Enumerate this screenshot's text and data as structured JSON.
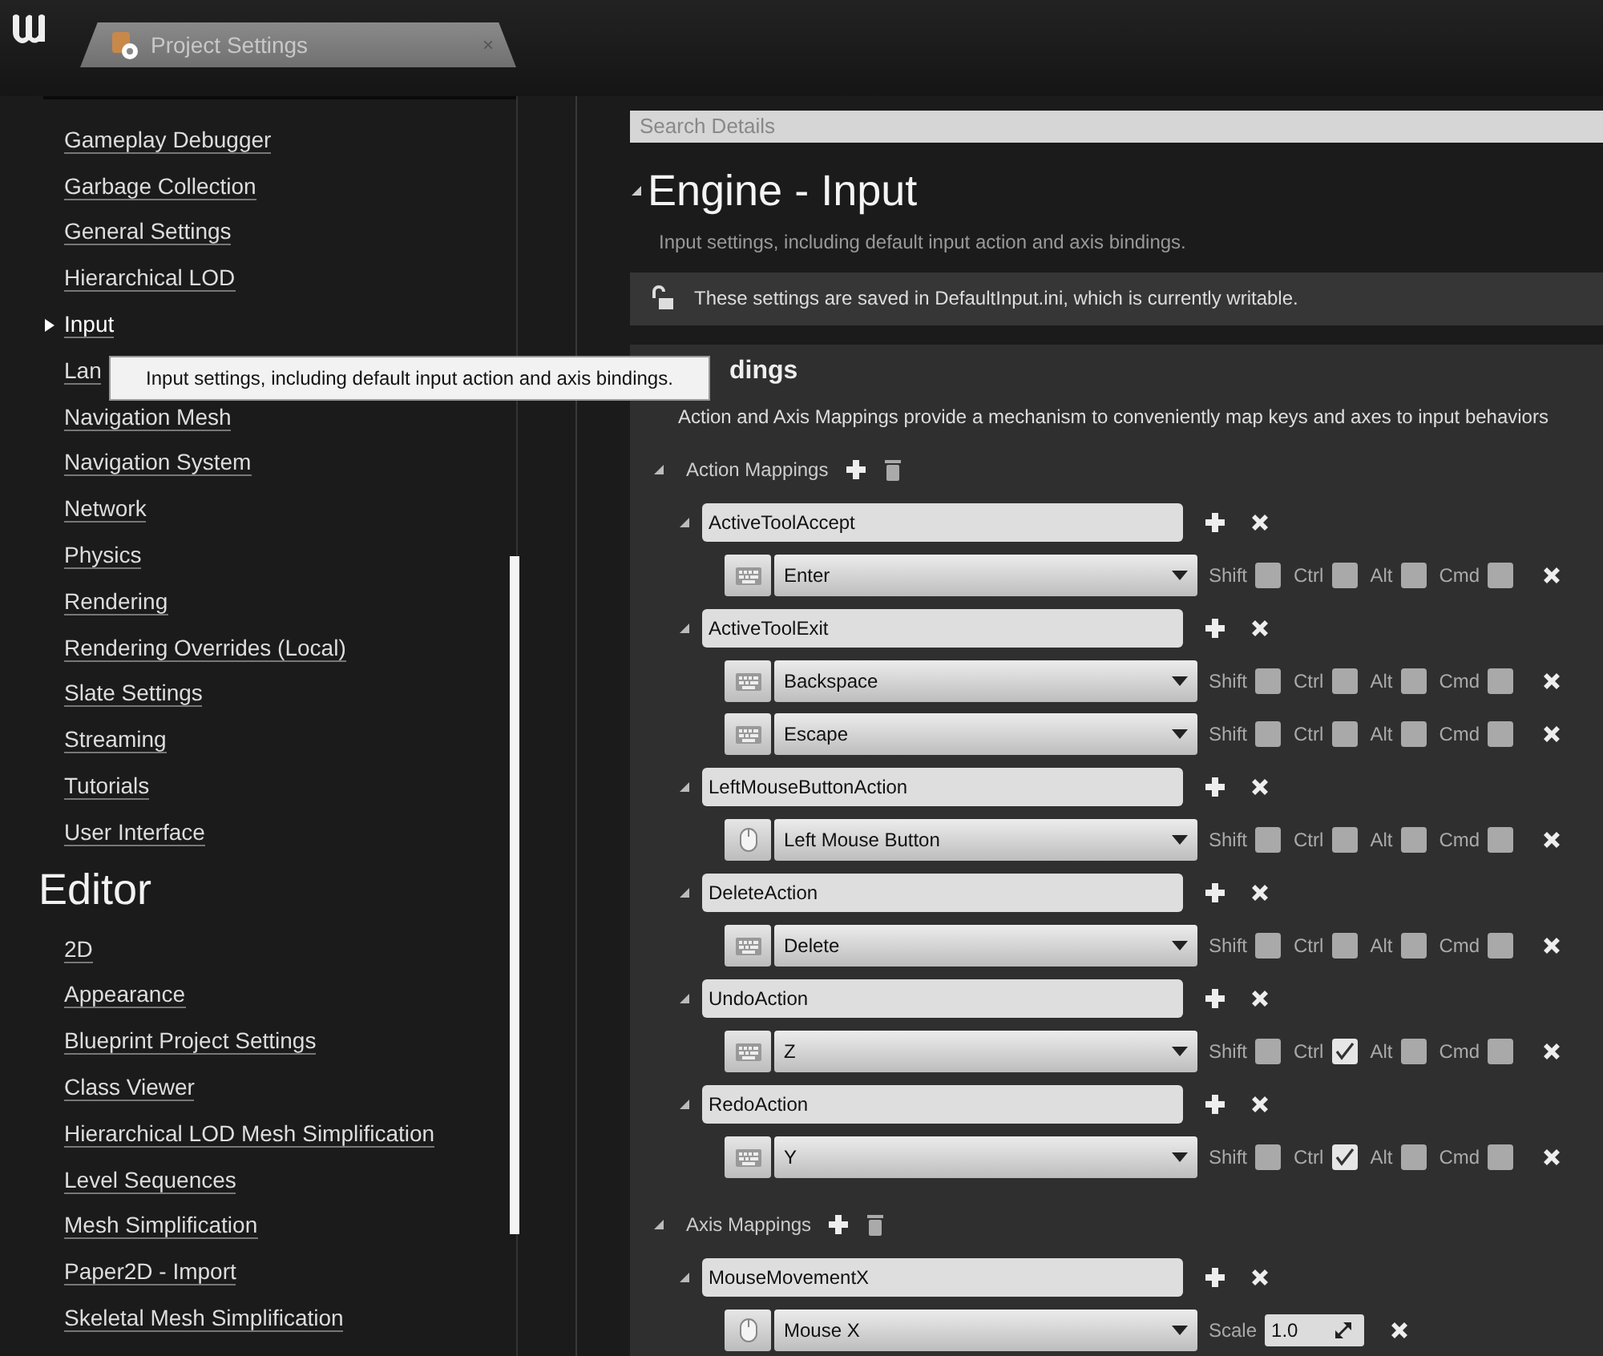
{
  "tab": {
    "title": "Project Settings",
    "close": "×"
  },
  "sidebar": {
    "engine_items": [
      {
        "label": "Gameplay Debugger",
        "selected": false
      },
      {
        "label": "Garbage Collection",
        "selected": false
      },
      {
        "label": "General Settings",
        "selected": false
      },
      {
        "label": "Hierarchical LOD",
        "selected": false
      },
      {
        "label": "Input",
        "selected": true
      },
      {
        "label": "Lan",
        "selected": false
      },
      {
        "label": "Navigation Mesh",
        "selected": false
      },
      {
        "label": "Navigation System",
        "selected": false
      },
      {
        "label": "Network",
        "selected": false
      },
      {
        "label": "Physics",
        "selected": false
      },
      {
        "label": "Rendering",
        "selected": false
      },
      {
        "label": "Rendering Overrides (Local)",
        "selected": false
      },
      {
        "label": "Slate Settings",
        "selected": false
      },
      {
        "label": "Streaming",
        "selected": false
      },
      {
        "label": "Tutorials",
        "selected": false
      },
      {
        "label": "User Interface",
        "selected": false
      }
    ],
    "editor_section": {
      "title": "Editor",
      "items": [
        {
          "label": "2D",
          "selected": false
        },
        {
          "label": "Appearance",
          "selected": false
        },
        {
          "label": "Blueprint Project Settings",
          "selected": false
        },
        {
          "label": "Class Viewer",
          "selected": false
        },
        {
          "label": "Hierarchical LOD Mesh Simplification",
          "selected": false
        },
        {
          "label": "Level Sequences",
          "selected": false
        },
        {
          "label": "Mesh Simplification",
          "selected": false
        },
        {
          "label": "Paper2D - Import",
          "selected": false
        },
        {
          "label": "Skeletal Mesh Simplification",
          "selected": false
        }
      ]
    }
  },
  "tooltip": "Input settings, including default input action and axis bindings.",
  "search": {
    "placeholder": "Search Details"
  },
  "header": {
    "title": "Engine - Input",
    "description": "Input settings, including default input action and axis bindings."
  },
  "notice": "These settings are saved in DefaultInput.ini, which is currently writable.",
  "bindings": {
    "title": "dings",
    "description": "Action and Axis Mappings provide a mechanism to conveniently map keys and axes to input behaviors",
    "action_mappings": {
      "label": "Action Mappings",
      "mappings": [
        {
          "name": "ActiveToolAccept",
          "keys": [
            {
              "key": "Enter",
              "kind": "keyboard",
              "modifiers": [
                {
                  "label": "Shift",
                  "checked": false
                },
                {
                  "label": "Ctrl",
                  "checked": false
                },
                {
                  "label": "Alt",
                  "checked": false
                },
                {
                  "label": "Cmd",
                  "checked": false
                }
              ]
            }
          ]
        },
        {
          "name": "ActiveToolExit",
          "keys": [
            {
              "key": "Backspace",
              "kind": "keyboard",
              "modifiers": [
                {
                  "label": "Shift",
                  "checked": false
                },
                {
                  "label": "Ctrl",
                  "checked": false
                },
                {
                  "label": "Alt",
                  "checked": false
                },
                {
                  "label": "Cmd",
                  "checked": false
                }
              ]
            },
            {
              "key": "Escape",
              "kind": "keyboard",
              "modifiers": [
                {
                  "label": "Shift",
                  "checked": false
                },
                {
                  "label": "Ctrl",
                  "checked": false
                },
                {
                  "label": "Alt",
                  "checked": false
                },
                {
                  "label": "Cmd",
                  "checked": false
                }
              ]
            }
          ]
        },
        {
          "name": "LeftMouseButtonAction",
          "keys": [
            {
              "key": "Left Mouse Button",
              "kind": "mouse",
              "modifiers": [
                {
                  "label": "Shift",
                  "checked": false
                },
                {
                  "label": "Ctrl",
                  "checked": false
                },
                {
                  "label": "Alt",
                  "checked": false
                },
                {
                  "label": "Cmd",
                  "checked": false
                }
              ]
            }
          ]
        },
        {
          "name": "DeleteAction",
          "keys": [
            {
              "key": "Delete",
              "kind": "keyboard",
              "modifiers": [
                {
                  "label": "Shift",
                  "checked": false
                },
                {
                  "label": "Ctrl",
                  "checked": false
                },
                {
                  "label": "Alt",
                  "checked": false
                },
                {
                  "label": "Cmd",
                  "checked": false
                }
              ]
            }
          ]
        },
        {
          "name": "UndoAction",
          "keys": [
            {
              "key": "Z",
              "kind": "keyboard",
              "modifiers": [
                {
                  "label": "Shift",
                  "checked": false
                },
                {
                  "label": "Ctrl",
                  "checked": true
                },
                {
                  "label": "Alt",
                  "checked": false
                },
                {
                  "label": "Cmd",
                  "checked": false
                }
              ]
            }
          ]
        },
        {
          "name": "RedoAction",
          "keys": [
            {
              "key": "Y",
              "kind": "keyboard",
              "modifiers": [
                {
                  "label": "Shift",
                  "checked": false
                },
                {
                  "label": "Ctrl",
                  "checked": true
                },
                {
                  "label": "Alt",
                  "checked": false
                },
                {
                  "label": "Cmd",
                  "checked": false
                }
              ]
            }
          ]
        }
      ]
    },
    "axis_mappings": {
      "label": "Axis Mappings",
      "mappings": [
        {
          "name": "MouseMovementX",
          "keys": [
            {
              "key": "Mouse X",
              "kind": "mouse",
              "scale_label": "Scale",
              "scale": "1.0"
            }
          ]
        }
      ]
    }
  }
}
